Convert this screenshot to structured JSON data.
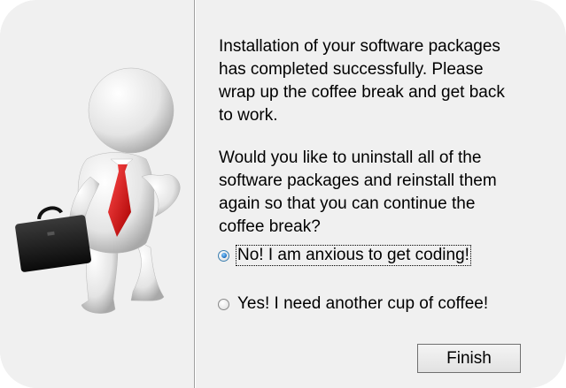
{
  "message": {
    "paragraph1": "Installation of your software packages\nhas completed successfully. Please\nwrap up the coffee break and get back\nto work.",
    "paragraph2": "Would you like to uninstall all of the\nsoftware packages and reinstall them\nagain so that you can continue the\ncoffee break?"
  },
  "options": [
    {
      "label": "No! I am anxious to get coding!",
      "selected": true
    },
    {
      "label": "Yes! I need another cup of coffee!",
      "selected": false
    }
  ],
  "buttons": {
    "finish_label": "Finish"
  },
  "illustration": {
    "icon": "businessman-with-briefcase",
    "tie_color": "#d8141c",
    "briefcase_color": "#1a1a1a"
  }
}
